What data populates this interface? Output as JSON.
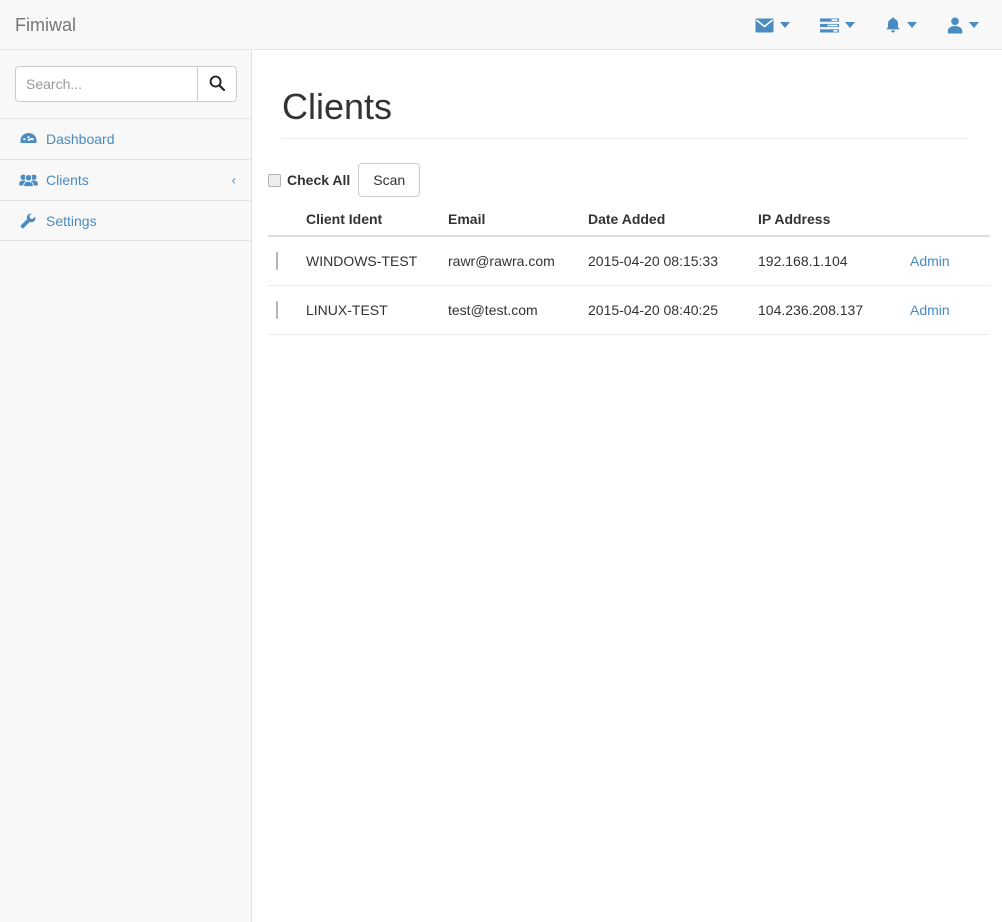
{
  "navbar": {
    "brand": "Fimiwal",
    "items": [
      {
        "icon": "envelope-icon",
        "name": "messages-dropdown"
      },
      {
        "icon": "tasks-icon",
        "name": "tasks-dropdown"
      },
      {
        "icon": "bell-icon",
        "name": "alerts-dropdown"
      },
      {
        "icon": "user-icon",
        "name": "user-dropdown"
      }
    ],
    "accent_color": "#4a8bc2"
  },
  "sidebar": {
    "search": {
      "placeholder": "Search...",
      "value": "",
      "button_icon": "search-icon"
    },
    "items": [
      {
        "label": "Dashboard",
        "icon": "dashboard-icon",
        "chevron": ""
      },
      {
        "label": "Clients",
        "icon": "users-icon",
        "chevron": "‹"
      },
      {
        "label": "Settings",
        "icon": "wrench-icon",
        "chevron": ""
      }
    ]
  },
  "main": {
    "title": "Clients",
    "toolbar": {
      "check_all_label": "Check All",
      "check_all_checked": false,
      "scan_label": "Scan"
    },
    "table": {
      "columns": [
        "",
        "Client Ident",
        "Email",
        "Date Added",
        "IP Address",
        ""
      ],
      "rows": [
        {
          "checked": false,
          "client_ident": "WINDOWS-TEST",
          "email": "rawr@rawra.com",
          "date_added": "2015-04-20 08:15:33",
          "ip_address": "192.168.1.104",
          "action": "Admin"
        },
        {
          "checked": false,
          "client_ident": "LINUX-TEST",
          "email": "test@test.com",
          "date_added": "2015-04-20 08:40:25",
          "ip_address": "104.236.208.137",
          "action": "Admin"
        }
      ]
    }
  }
}
